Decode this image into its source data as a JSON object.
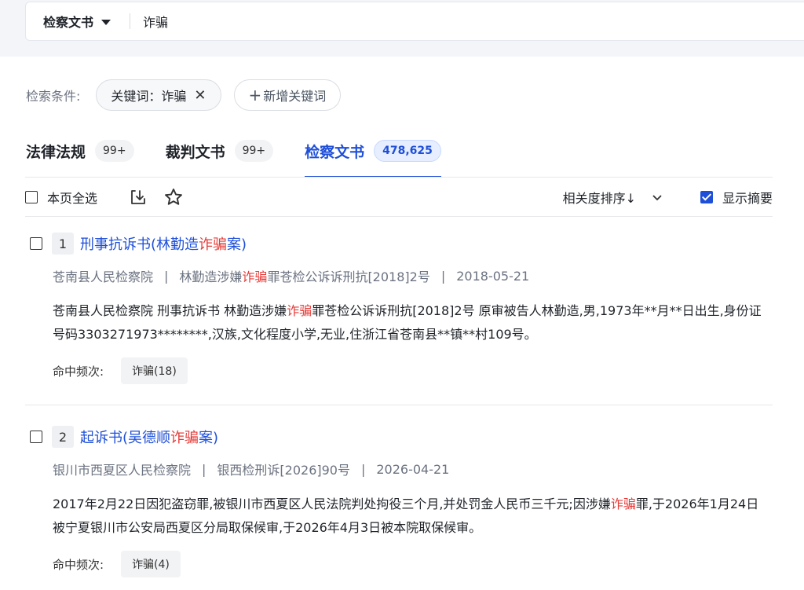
{
  "search": {
    "scope": "检察文书",
    "query": "诈骗"
  },
  "conditions": {
    "label": "检索条件:",
    "keyword_chip": "关键词：诈骗",
    "add_chip": "新增关键词"
  },
  "tabs": [
    {
      "label": "法律法规",
      "count": "99+"
    },
    {
      "label": "裁判文书",
      "count": "99+"
    },
    {
      "label": "检察文书",
      "count": "478,625",
      "active": true
    }
  ],
  "toolbar": {
    "select_all": "本页全选",
    "sort_label": "相关度排序↓",
    "show_summary": "显示摘要"
  },
  "results": [
    {
      "index": "1",
      "title_pre": "刑事抗诉书(林勤造",
      "title_hl": "诈骗",
      "title_post": "案)",
      "court": "苍南县人民检察院",
      "case_pre": "林勤造涉嫌",
      "case_hl": "诈骗",
      "case_post": "罪苍检公诉诉刑抗[2018]2号",
      "date": "2018-05-21",
      "body_pre": "苍南县人民检察院 刑事抗诉书 林勤造涉嫌",
      "body_hl": "诈骗",
      "body_post": "罪苍检公诉诉刑抗[2018]2号 原审被告人林勤造,男,1973年**月**日出生,身份证号码3303271973********,汉族,文化程度小学,无业,住浙江省苍南县**镇**村109号。",
      "hits_label": "命中频次:",
      "hits_chip": "诈骗(18)"
    },
    {
      "index": "2",
      "title_pre": "起诉书(吴德顺",
      "title_hl": "诈骗",
      "title_post": "案)",
      "court": "银川市西夏区人民检察院",
      "case_pre": "银西检刑诉[2026]90号",
      "case_hl": "",
      "case_post": "",
      "date": "2026-04-21",
      "body_pre": "2017年2月22日因犯盗窃罪,被银川市西夏区人民法院判处拘役三个月,并处罚金人民币三千元;因涉嫌",
      "body_hl": "诈骗",
      "body_post": "罪,于2026年1月24日被宁夏银川市公安局西夏区分局取保候审,于2026年4月3日被本院取保候审。",
      "hits_label": "命中频次:",
      "hits_chip": "诈骗(4)"
    }
  ]
}
